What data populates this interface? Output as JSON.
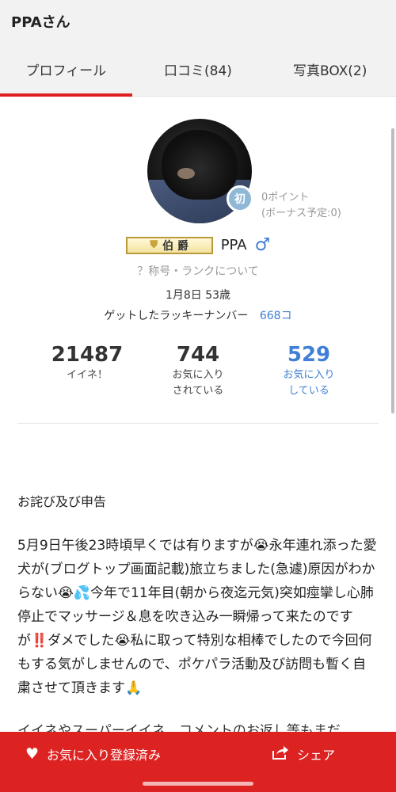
{
  "header": {
    "title": "PPAさん"
  },
  "tabs": [
    {
      "label": "プロフィール",
      "active": true
    },
    {
      "label": "口コミ(84)"
    },
    {
      "label": "写真BOX(2)"
    }
  ],
  "profile": {
    "beginner_mark": "初",
    "points_line1": "0ポイント",
    "points_line2": "(ボーナス予定:0)",
    "rank_title": "伯 爵",
    "username": "PPA",
    "gender_symbol": "♂",
    "rank_help": "？称号・ランクについて",
    "birth": "1月8日 53歳",
    "lucky_label": "ゲットしたラッキーナンバー",
    "lucky_value": "668コ"
  },
  "stats": [
    {
      "value": "21487",
      "label": "イイネ！"
    },
    {
      "value": "744",
      "label": "お気に入り\nされている"
    },
    {
      "value": "529",
      "label": "お気に入り\nしている"
    }
  ],
  "post": {
    "title": "お詫び及び申告",
    "body": "5月9日午後23時頃早くでは有りますが😭永年連れ添った愛犬が(ブログトップ画面記載)旅立ちました(急遽)原因がわからない😭💦今年で11年目(朝から夜迄元気)突如痙攣し心肺停止でマッサージ＆息を吹き込み一瞬帰って来たのですが‼️ダメでした😭私に取って特別な相棒でしたので今回何もする気がしませんので、ポケパラ活動及び訪問も暫く自粛させて頂きます🙏",
    "more": "イイネやスーパーイイネ、コメントのお返し等もまだ"
  },
  "bottom_bar": {
    "favorite_label": "お気に入り登録済み",
    "share_label": "シェア"
  },
  "colors": {
    "accent": "#dd2222",
    "link": "#3f7fd6",
    "rank_gold": "#c9a43a"
  }
}
